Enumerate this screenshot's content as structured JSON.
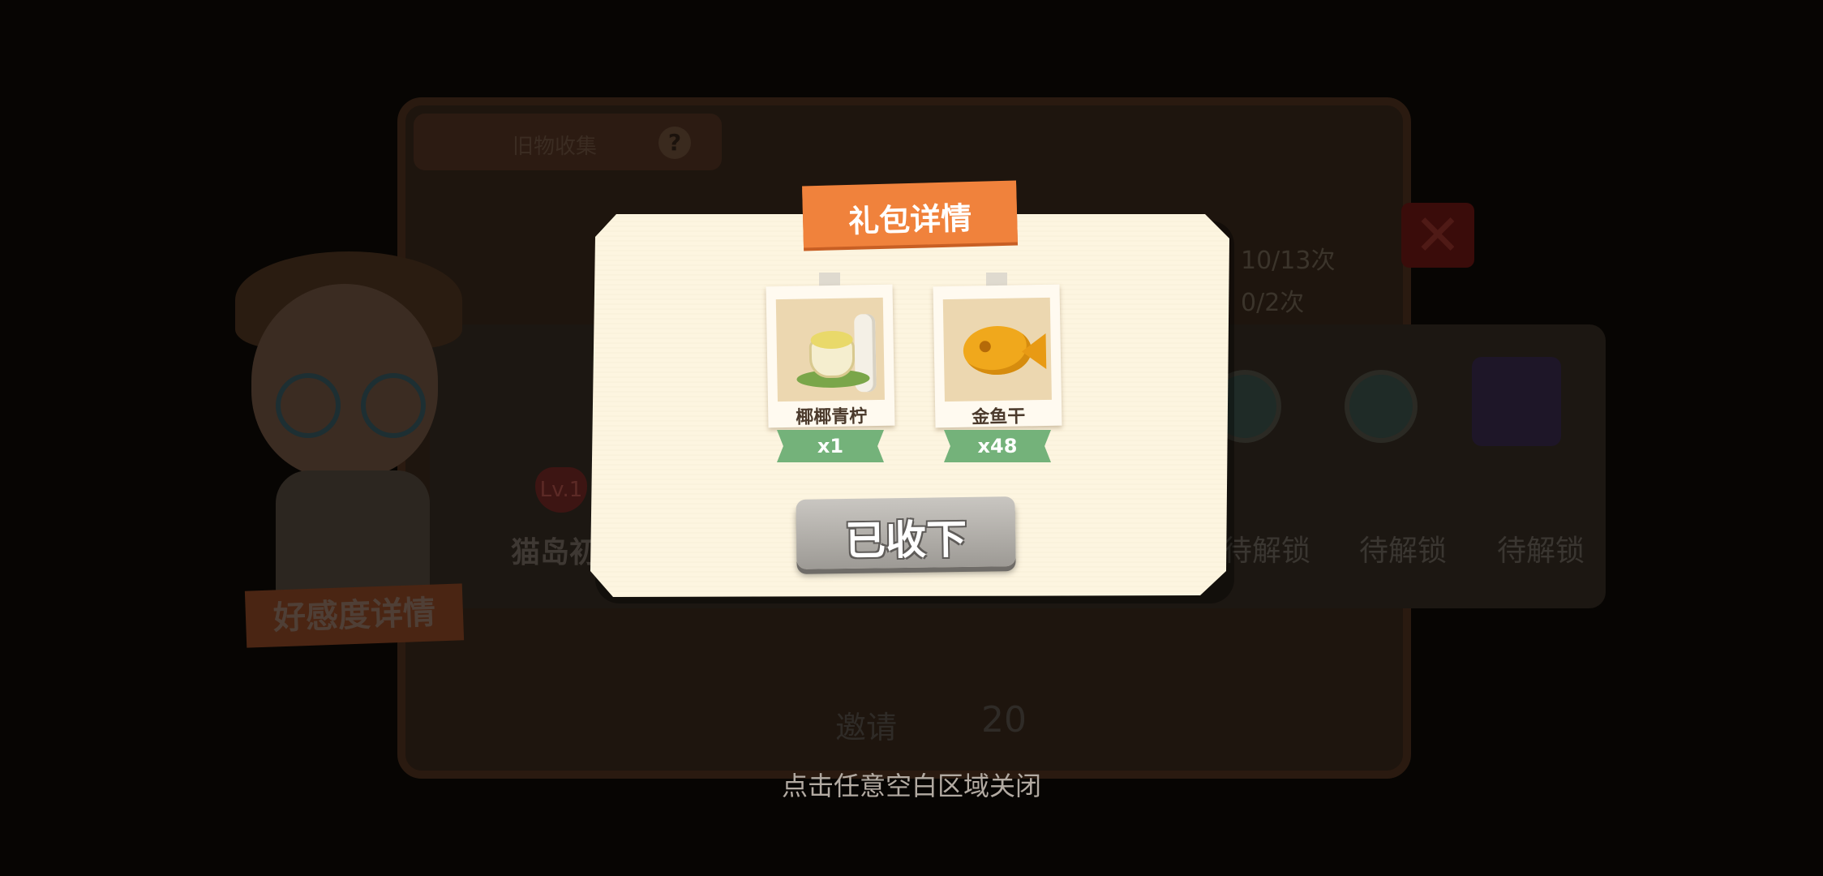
{
  "background": {
    "header_label": "旧物收集",
    "help_icon": "question-icon",
    "quota_1": "10/13次",
    "quota_2": "0/2次",
    "level_badge": "Lv.1",
    "character_name": "猫岛初",
    "affinity_button": "好感度详情",
    "invite_label": "邀请",
    "invite_cost": "20",
    "locked_label": "待解锁",
    "close_icon": "close-x-icon"
  },
  "popup": {
    "title": "礼包详情",
    "items": [
      {
        "name": "椰椰青柠",
        "quantity": "x1",
        "icon": "coconut-lime-drink-icon"
      },
      {
        "name": "金鱼干",
        "quantity": "x48",
        "icon": "golden-fish-icon"
      }
    ],
    "accept_button": "已收下"
  },
  "hint": "点击任意空白区域关闭",
  "colors": {
    "banner": "#f0823c",
    "panel": "#fdf5e0",
    "ribbon": "#74b27a",
    "button": "#b3b0ab"
  }
}
